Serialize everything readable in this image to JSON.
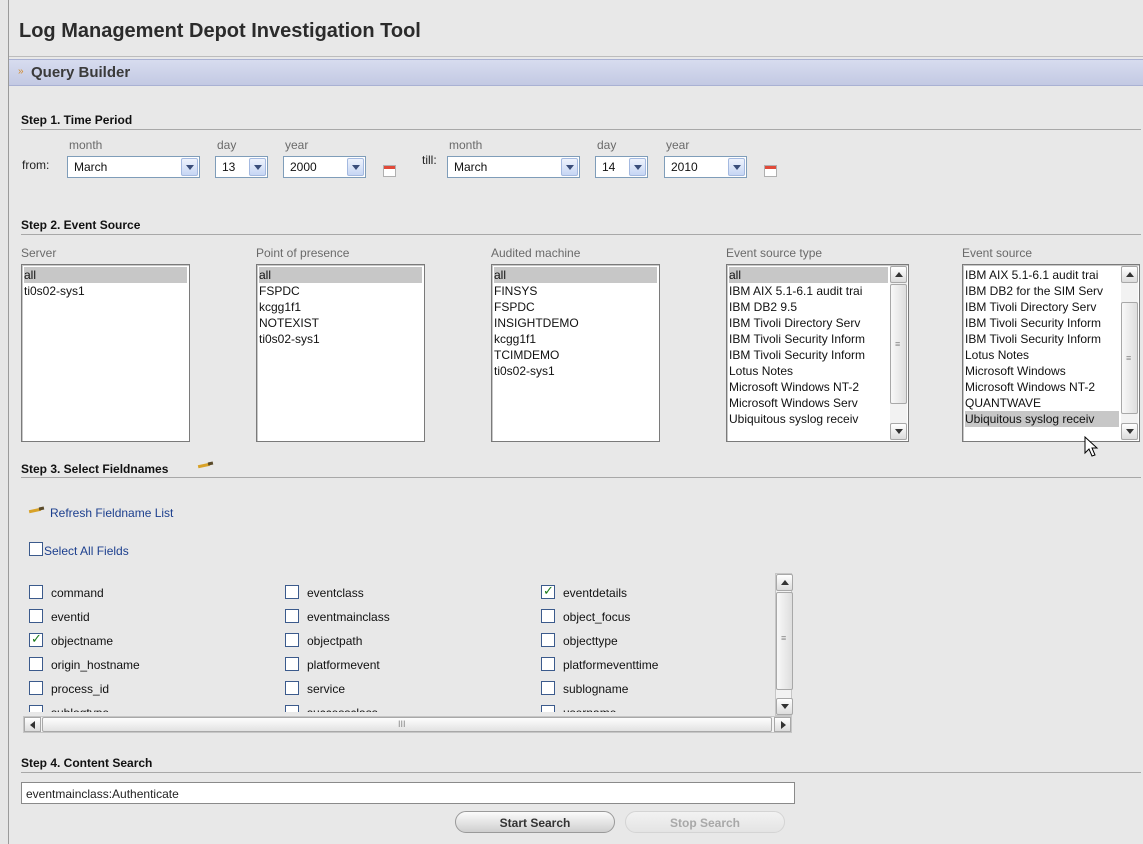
{
  "app": {
    "title": "Log Management Depot Investigation Tool"
  },
  "query_builder": {
    "label": "Query Builder",
    "chevron": "»"
  },
  "step1": {
    "title": "Step 1. Time Period",
    "from_label": "from:",
    "till_label": "till:",
    "month_label": "month",
    "day_label": "day",
    "year_label": "year",
    "from": {
      "month": "March",
      "day": "13",
      "year": "2000"
    },
    "till": {
      "month": "March",
      "day": "14",
      "year": "2010"
    },
    "calendar_icon": "calendar-icon"
  },
  "step2": {
    "title": "Step 2. Event Source",
    "lists": [
      {
        "header": "Server",
        "items": [
          "all",
          "ti0s02-sys1"
        ],
        "selected": 0
      },
      {
        "header": "Point of presence",
        "items": [
          "all",
          "FSPDC",
          "kcgg1f1",
          "NOTEXIST",
          "ti0s02-sys1"
        ],
        "selected": 0
      },
      {
        "header": "Audited machine",
        "items": [
          "all",
          "FINSYS",
          "FSPDC",
          "INSIGHTDEMO",
          "kcgg1f1",
          "TCIMDEMO",
          "ti0s02-sys1"
        ],
        "selected": 0
      },
      {
        "header": "Event source type",
        "items": [
          "all",
          "IBM AIX 5.1-6.1 audit trai",
          "IBM DB2 9.5",
          "IBM Tivoli Directory Serv",
          "IBM Tivoli Security Inform",
          "IBM Tivoli Security Inform",
          "Lotus Notes",
          "Microsoft Windows NT-2",
          "Microsoft Windows Serv",
          "Ubiquitous syslog receiv"
        ],
        "selected": 0
      },
      {
        "header": "Event source",
        "items": [
          "IBM AIX 5.1-6.1 audit trai",
          "IBM DB2 for the SIM Serv",
          "IBM Tivoli Directory Serv",
          "IBM Tivoli Security Inform",
          "IBM Tivoli Security Inform",
          "Lotus Notes",
          "Microsoft Windows",
          "Microsoft Windows NT-2",
          "QUANTWAVE",
          "Ubiquitous syslog receiv"
        ],
        "selected": 9
      }
    ]
  },
  "step3": {
    "title": "Step 3. Select Fieldnames",
    "refresh_label": "Refresh Fieldname List",
    "select_all_label": "Select All Fields",
    "fields": [
      {
        "name": "command",
        "checked": false
      },
      {
        "name": "eventclass",
        "checked": false
      },
      {
        "name": "eventdetails",
        "checked": true
      },
      {
        "name": "eventid",
        "checked": false
      },
      {
        "name": "eventmainclass",
        "checked": false
      },
      {
        "name": "object_focus",
        "checked": false
      },
      {
        "name": "objectname",
        "checked": true
      },
      {
        "name": "objectpath",
        "checked": false
      },
      {
        "name": "objecttype",
        "checked": false
      },
      {
        "name": "origin_hostname",
        "checked": false
      },
      {
        "name": "platformevent",
        "checked": false
      },
      {
        "name": "platformeventtime",
        "checked": false
      },
      {
        "name": "process_id",
        "checked": false
      },
      {
        "name": "service",
        "checked": false
      },
      {
        "name": "sublogname",
        "checked": false
      },
      {
        "name": "sublogtype",
        "checked": false
      },
      {
        "name": "successclass",
        "checked": false
      },
      {
        "name": "username",
        "checked": false
      }
    ]
  },
  "step4": {
    "title": "Step 4. Content Search",
    "query": "eventmainclass:Authenticate",
    "start_label": "Start Search",
    "stop_label": "Stop Search"
  }
}
